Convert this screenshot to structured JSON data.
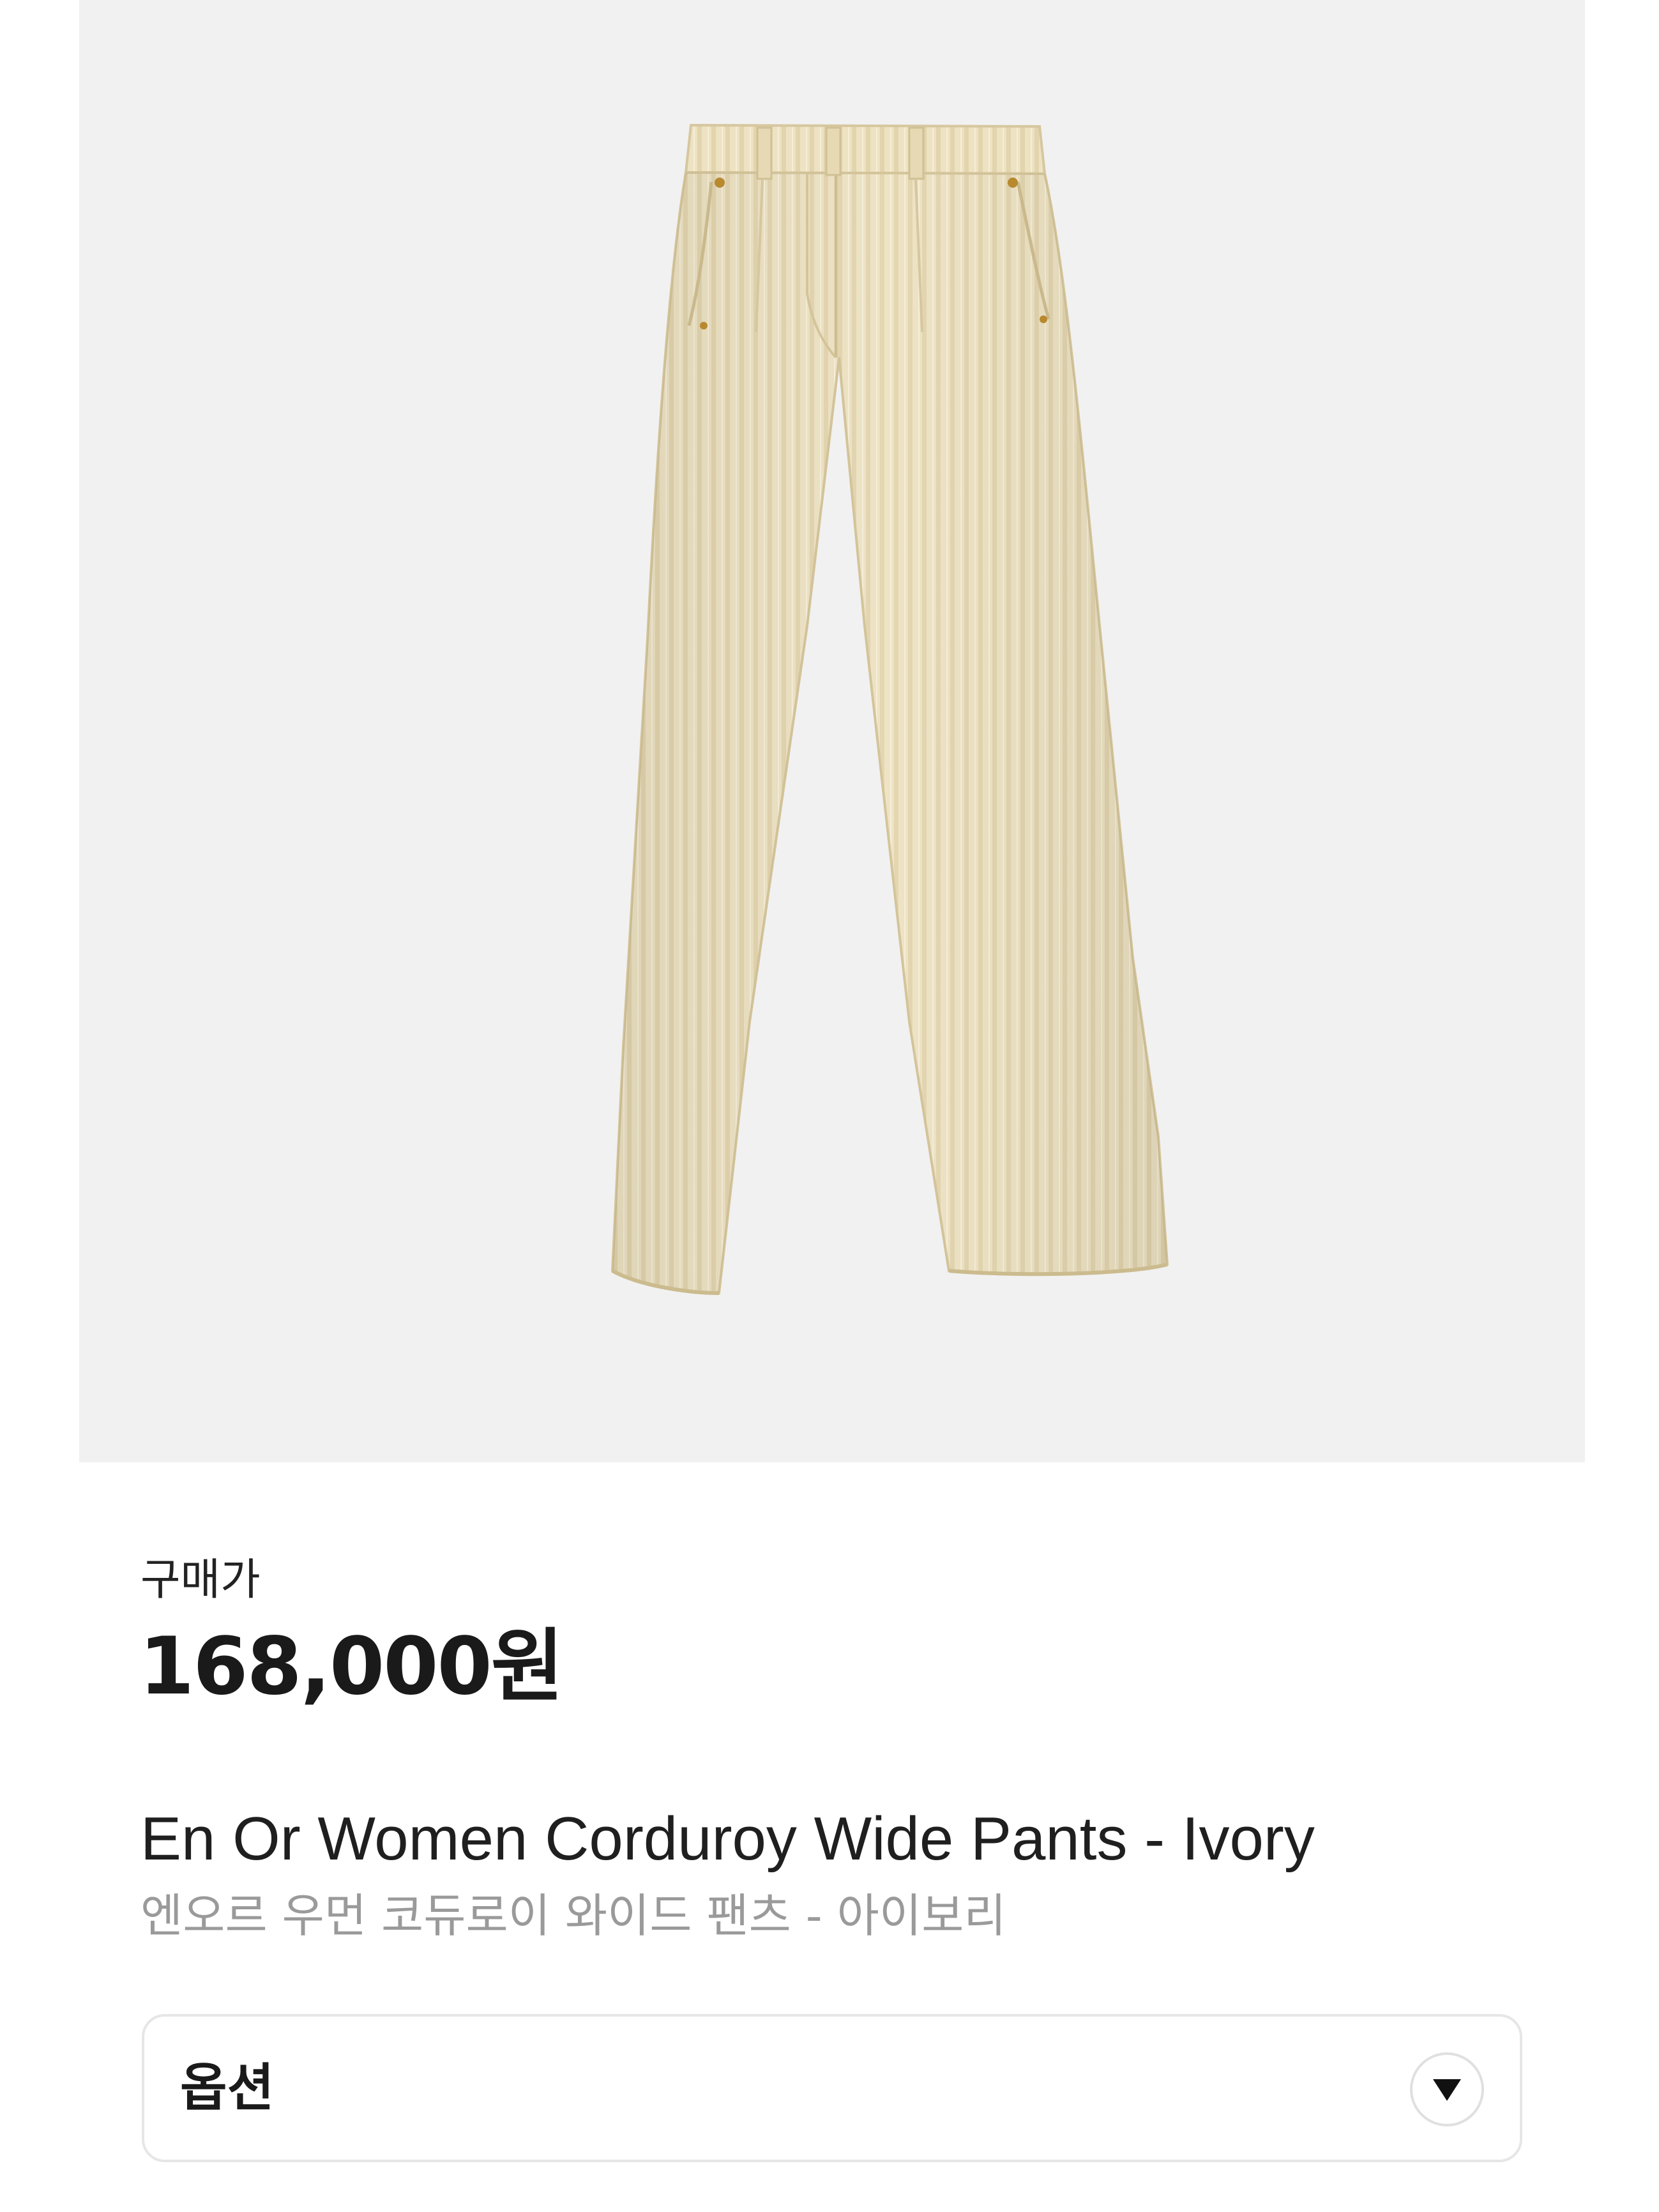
{
  "product": {
    "image_icon": "corduroy-wide-pants-image",
    "image_background": "#f1f1f1",
    "garment_color": "#ece0bf",
    "price_label": "구매가",
    "price": "168,000원",
    "name_en": "En Or Women Corduroy Wide Pants - Ivory",
    "name_ko": "엔오르 우먼 코듀로이 와이드 팬츠 - 아이보리"
  },
  "option": {
    "label": "옵션",
    "icon": "caret-down-icon"
  }
}
